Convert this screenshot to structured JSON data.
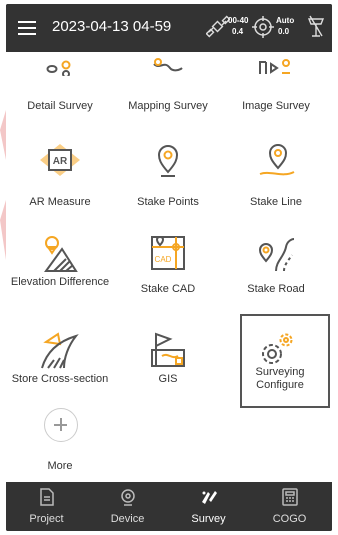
{
  "status_bar": {
    "datetime": "2023-04-13 04-59",
    "sat_top": "00-40",
    "sat_bottom": "0.4",
    "fix_top": "Auto",
    "fix_bottom": "0.0"
  },
  "tiles": [
    {
      "label": "Detail Survey",
      "icon": "detail-survey-icon"
    },
    {
      "label": "Mapping Survey",
      "icon": "mapping-survey-icon"
    },
    {
      "label": "Image Survey",
      "icon": "image-survey-icon"
    },
    {
      "label": "AR Measure",
      "icon": "ar-measure-icon",
      "badge": "AR"
    },
    {
      "label": "Stake Points",
      "icon": "stake-points-icon"
    },
    {
      "label": "Stake Line",
      "icon": "stake-line-icon"
    },
    {
      "label": "Elevation Difference",
      "icon": "elevation-difference-icon"
    },
    {
      "label": "Stake CAD",
      "icon": "stake-cad-icon",
      "badge": "CAD"
    },
    {
      "label": "Stake Road",
      "icon": "stake-road-icon"
    },
    {
      "label": "Store Cross-section",
      "icon": "store-cross-section-icon"
    },
    {
      "label": "GIS",
      "icon": "gis-icon"
    },
    {
      "label": "Surveying Configure",
      "icon": "surveying-configure-icon"
    }
  ],
  "more": {
    "label": "More"
  },
  "tabs": [
    {
      "label": "Project",
      "icon": "project-icon"
    },
    {
      "label": "Device",
      "icon": "device-icon"
    },
    {
      "label": "Survey",
      "icon": "survey-icon",
      "active": true
    },
    {
      "label": "COGO",
      "icon": "cogo-icon"
    }
  ],
  "colors": {
    "accent": "#F5A623",
    "dark": "#333333",
    "icon_line": "#555555"
  }
}
